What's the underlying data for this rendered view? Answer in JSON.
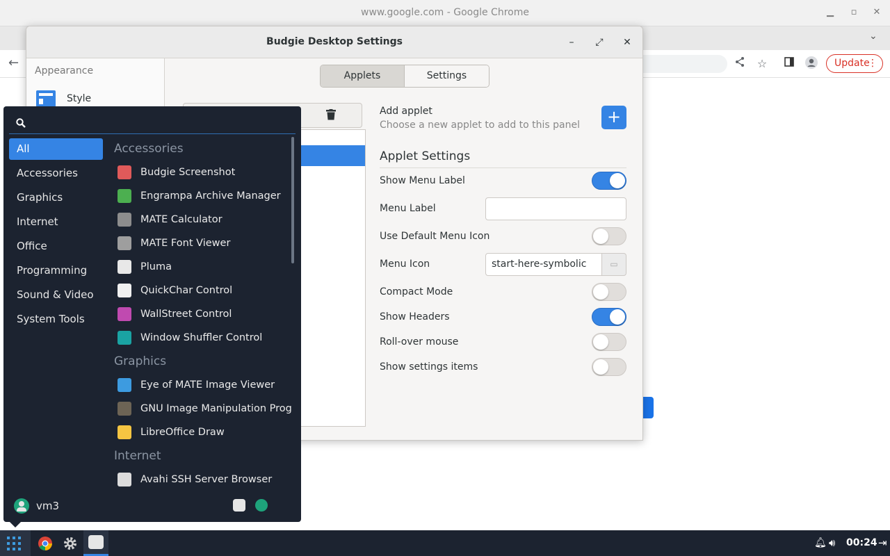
{
  "chrome": {
    "title": "www.google.com - Google Chrome",
    "update_label": "Update"
  },
  "settings_window": {
    "title": "Budgie Desktop Settings",
    "sidebar": {
      "heading": "Appearance",
      "item": "Style"
    },
    "tabs": [
      "Applets",
      "Settings"
    ],
    "add_applet": {
      "title": "Add applet",
      "subtitle": "Choose a new applet to add to this panel",
      "button": "+"
    },
    "applet_settings_title": "Applet Settings",
    "rows": [
      {
        "label": "Show Menu Label",
        "type": "toggle",
        "on": true
      },
      {
        "label": "Menu Label",
        "type": "text",
        "value": ""
      },
      {
        "label": "Use Default Menu Icon",
        "type": "toggle",
        "on": false
      },
      {
        "label": "Menu Icon",
        "type": "icon",
        "value": "start-here-symbolic"
      },
      {
        "label": "Compact Mode",
        "type": "toggle",
        "on": false
      },
      {
        "label": "Show Headers",
        "type": "toggle",
        "on": true
      },
      {
        "label": "Roll-over mouse",
        "type": "toggle",
        "on": false
      },
      {
        "label": "Show settings items",
        "type": "toggle",
        "on": false
      }
    ]
  },
  "menu": {
    "search_value": "",
    "categories": [
      "All",
      "Accessories",
      "Graphics",
      "Internet",
      "Office",
      "Programming",
      "Sound & Video",
      "System Tools"
    ],
    "selected_category": "All",
    "sections": [
      {
        "header": "Accessories",
        "apps": [
          {
            "name": "Budgie Screenshot",
            "icon": "camera-icon",
            "color": "#e05a5a"
          },
          {
            "name": "Engrampa Archive Manager",
            "icon": "archive-icon",
            "color": "#4caf50"
          },
          {
            "name": "MATE Calculator",
            "icon": "calculator-icon",
            "color": "#8d8d8d"
          },
          {
            "name": "MATE Font Viewer",
            "icon": "font-icon",
            "color": "#9e9e9e"
          },
          {
            "name": "Pluma",
            "icon": "text-editor-icon",
            "color": "#e8e8e8"
          },
          {
            "name": "QuickChar Control",
            "icon": "quickchar-icon",
            "color": "#f0f0f0"
          },
          {
            "name": "WallStreet Control",
            "icon": "wallstreet-icon",
            "color": "#c04ab0"
          },
          {
            "name": "Window Shuffler Control",
            "icon": "shuffler-icon",
            "color": "#1aa3a3"
          }
        ]
      },
      {
        "header": "Graphics",
        "apps": [
          {
            "name": "Eye of MATE Image Viewer",
            "icon": "image-viewer-icon",
            "color": "#3d9be0"
          },
          {
            "name": "GNU Image Manipulation Progr…",
            "icon": "gimp-icon",
            "color": "#6d6455"
          },
          {
            "name": "LibreOffice Draw",
            "icon": "draw-icon",
            "color": "#f5c542"
          }
        ]
      },
      {
        "header": "Internet",
        "apps": [
          {
            "name": "Avahi SSH Server Browser",
            "icon": "terminal-icon",
            "color": "#dcdcdc"
          }
        ]
      }
    ],
    "user": "vm3"
  },
  "taskbar": {
    "clock": "00:24"
  }
}
